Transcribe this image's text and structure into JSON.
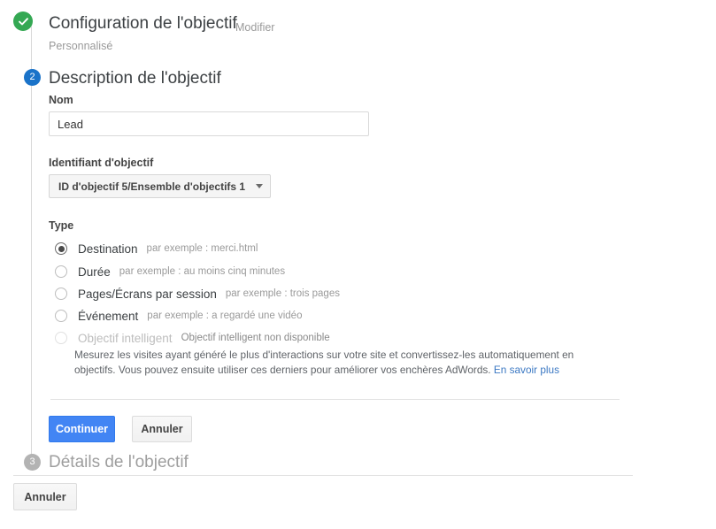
{
  "steps": [
    {
      "marker": "check-icon",
      "state": "done",
      "title": "Configuration de l'objectif",
      "edit_label": "Modifier",
      "subtitle": "Personnalisé"
    },
    {
      "marker": "2",
      "state": "active",
      "title": "Description de l'objectif"
    },
    {
      "marker": "3",
      "state": "pending",
      "title": "Détails de l'objectif"
    }
  ],
  "form": {
    "name_label": "Nom",
    "name_value": "Lead",
    "name_placeholder": "",
    "goal_id_label": "Identifiant d'objectif",
    "goal_id_value": "ID d'objectif 5/Ensemble d'objectifs 1",
    "type_label": "Type",
    "types": [
      {
        "label": "Destination",
        "hint": "par exemple : merci.html",
        "checked": true,
        "disabled": false
      },
      {
        "label": "Durée",
        "hint": "par exemple : au moins cinq minutes",
        "checked": false,
        "disabled": false
      },
      {
        "label": "Pages/Écrans par session",
        "hint": "par exemple : trois pages",
        "checked": false,
        "disabled": false
      },
      {
        "label": "Événement",
        "hint": "par exemple : a regardé une vidéo",
        "checked": false,
        "disabled": false
      },
      {
        "label": "Objectif intelligent",
        "hint": "Objectif intelligent non disponible",
        "checked": false,
        "disabled": true
      }
    ],
    "smart_goal_description": "Mesurez les visites ayant généré le plus d'interactions sur votre site et convertissez-les automatiquement en objectifs. Vous pouvez ensuite utiliser ces derniers pour améliorer vos enchères AdWords. ",
    "smart_goal_link": "En savoir plus"
  },
  "actions": {
    "continue_label": "Continuer",
    "cancel_label": "Annuler",
    "bottom_cancel_label": "Annuler"
  },
  "colors": {
    "done": "#34a853",
    "active": "#1a73c9",
    "pending": "#b3b3b3",
    "primary_button": "#4285f4",
    "link": "#3b78c3"
  }
}
